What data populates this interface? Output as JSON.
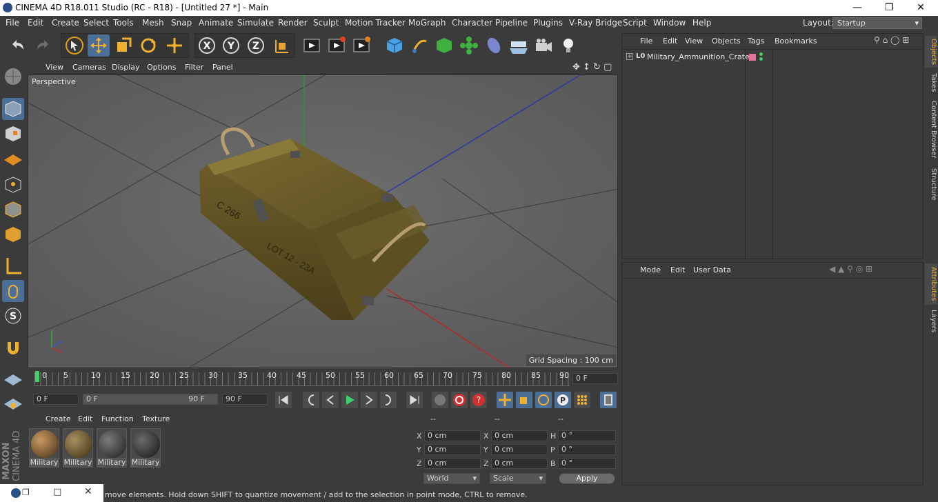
{
  "window": {
    "title": "CINEMA 4D R18.011 Studio (RC - R18) - [Untitled 27 *] - Main",
    "controls": [
      "minimize-icon",
      "restore-icon",
      "close-icon"
    ]
  },
  "menubar": {
    "items": [
      "File",
      "Edit",
      "Create",
      "Select",
      "Tools",
      "Mesh",
      "Snap",
      "Animate",
      "Simulate",
      "Render",
      "Sculpt",
      "Motion Tracker",
      "MoGraph",
      "Character",
      "Pipeline",
      "Plugins",
      "V-Ray Bridge",
      "Script",
      "Window",
      "Help"
    ],
    "layout_label": "Layout:",
    "layout_value": "Startup"
  },
  "viewport": {
    "menu": [
      "View",
      "Cameras",
      "Display",
      "Options",
      "Filter",
      "Panel"
    ],
    "camera_label": "Perspective",
    "grid_spacing": "Grid Spacing : 100 cm",
    "crate_text": [
      "C 266",
      "LOT 12 - 23A"
    ]
  },
  "timeline": {
    "ticks": [
      "0",
      "5",
      "10",
      "15",
      "20",
      "25",
      "30",
      "35",
      "40",
      "45",
      "50",
      "55",
      "60",
      "65",
      "70",
      "75",
      "80",
      "85",
      "90"
    ],
    "current_frame": "0 F"
  },
  "transport": {
    "start_field": "0 F",
    "range_start": "0 F",
    "range_end": "90 F",
    "end_field": "90 F"
  },
  "material_manager": {
    "menu": [
      "Create",
      "Edit",
      "Function",
      "Texture"
    ],
    "materials": [
      {
        "name": "Military",
        "color": "#8a6a42"
      },
      {
        "name": "Military",
        "color": "#6e5d3a"
      },
      {
        "name": "Military",
        "color": "#3e3e3e"
      },
      {
        "name": "Military",
        "color": "#2f2f2f"
      }
    ]
  },
  "coordinates": {
    "headers": [
      "--",
      "--",
      "--"
    ],
    "rows": [
      {
        "a": "X",
        "av": "0 cm",
        "b": "X",
        "bv": "0 cm",
        "c": "H",
        "cv": "0 °"
      },
      {
        "a": "Y",
        "av": "0 cm",
        "b": "Y",
        "bv": "0 cm",
        "c": "P",
        "cv": "0 °"
      },
      {
        "a": "Z",
        "av": "0 cm",
        "b": "Z",
        "bv": "0 cm",
        "c": "B",
        "cv": "0 °"
      }
    ],
    "world": "World",
    "scale": "Scale",
    "apply": "Apply"
  },
  "object_manager": {
    "menu": [
      "File",
      "Edit",
      "View",
      "Objects",
      "Tags",
      "Bookmarks"
    ],
    "object_name": "Military_Ammunition_Crate",
    "tag_color": "#e8739a"
  },
  "attribute_manager": {
    "menu": [
      "Mode",
      "Edit",
      "User Data"
    ]
  },
  "right_tabs": {
    "top": [
      "Objects",
      "Takes",
      "Content Browser",
      "Structure"
    ],
    "bottom": [
      "Attributes",
      "Layers"
    ]
  },
  "status": {
    "text": "move elements. Hold down SHIFT to quantize movement / add to the selection in point mode, CTRL to remove."
  },
  "brand": {
    "maxon": "MAXON",
    "cinema": "CINEMA 4D"
  }
}
